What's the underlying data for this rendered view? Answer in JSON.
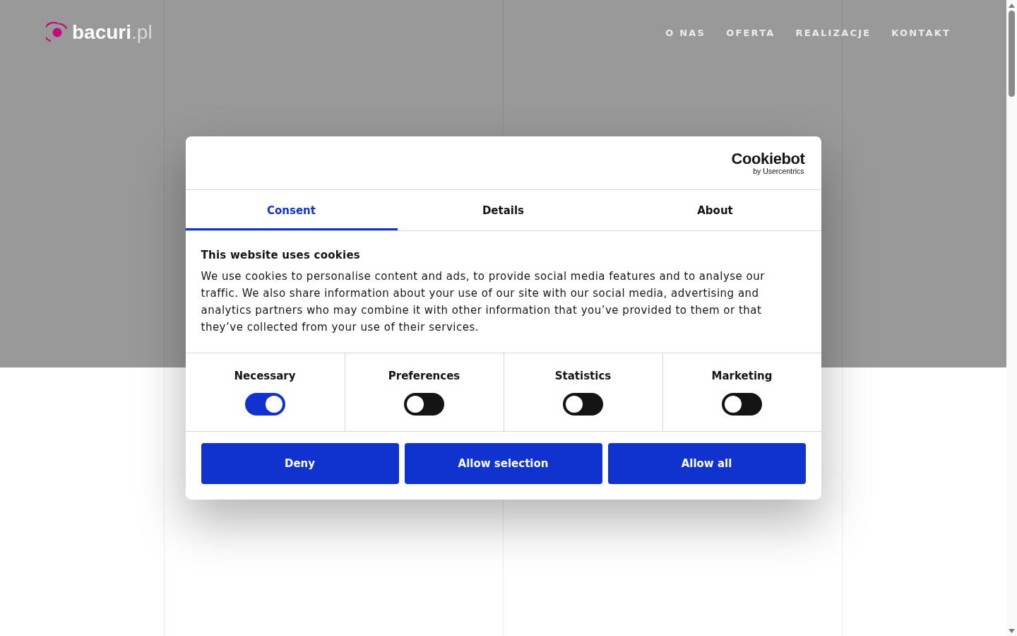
{
  "header": {
    "logo": {
      "text": "**bacuri**.pl"
    },
    "nav": [
      {
        "label": "O NAS"
      },
      {
        "label": "OFERTA"
      },
      {
        "label": "REALIZACJE"
      },
      {
        "label": "KONTAKT"
      }
    ]
  },
  "cookie_dialog": {
    "brand": {
      "name": "Cookiebot",
      "byline": "by Usercentrics"
    },
    "tabs": [
      {
        "label": "Consent",
        "selected": true
      },
      {
        "label": "Details",
        "selected": false
      },
      {
        "label": "About",
        "selected": false
      }
    ],
    "title": "This website uses cookies",
    "text": "We use cookies to personalise content and ads, to provide social media features and to analyse our traffic. We also share information about your use of our site with our social media, advertising and analytics partners who may combine it with other information that you’ve provided to them or that they’ve collected from your use of their services.",
    "categories": [
      {
        "label": "Necessary",
        "checked": true
      },
      {
        "label": "Preferences",
        "checked": false
      },
      {
        "label": "Statistics",
        "checked": false
      },
      {
        "label": "Marketing",
        "checked": false
      }
    ],
    "buttons": [
      {
        "label": "Deny"
      },
      {
        "label": "Allow selection"
      },
      {
        "label": "Allow all"
      }
    ]
  }
}
